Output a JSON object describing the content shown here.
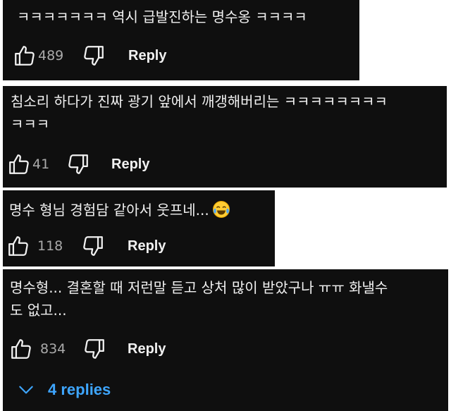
{
  "comments": [
    {
      "text": "ㅋㅋㅋㅋㅋㅋㅋ 역시 급발진하는 명수옹 ㅋㅋㅋㅋ",
      "likes": "489",
      "reply_label": "Reply"
    },
    {
      "text": "침소리 하다가 진짜 광기 앞에서 깨갱해버리는 ㅋㅋㅋㅋㅋㅋㅋㅋ\nㅋㅋㅋ",
      "likes": "41",
      "reply_label": "Reply"
    },
    {
      "text": "명수 형님 경험담 같아서 웃프네...",
      "emoji": "face-with-tears-of-joy",
      "likes": "118",
      "reply_label": "Reply"
    },
    {
      "text": "명수형... 결혼할 때 저런말 듣고 상처 많이 받았구나 ㅠㅠ 화낼수\n도 없고...",
      "likes": "834",
      "reply_label": "Reply",
      "replies_label": "4 replies"
    }
  ],
  "icons": {
    "like": "thumbs-up-icon",
    "dislike": "thumbs-down-icon",
    "expand": "chevron-down-icon"
  },
  "colors": {
    "card_bg": "#0f0f0f",
    "text": "#f1f1f1",
    "count": "#aaaaaa",
    "link": "#3ea6ff"
  }
}
